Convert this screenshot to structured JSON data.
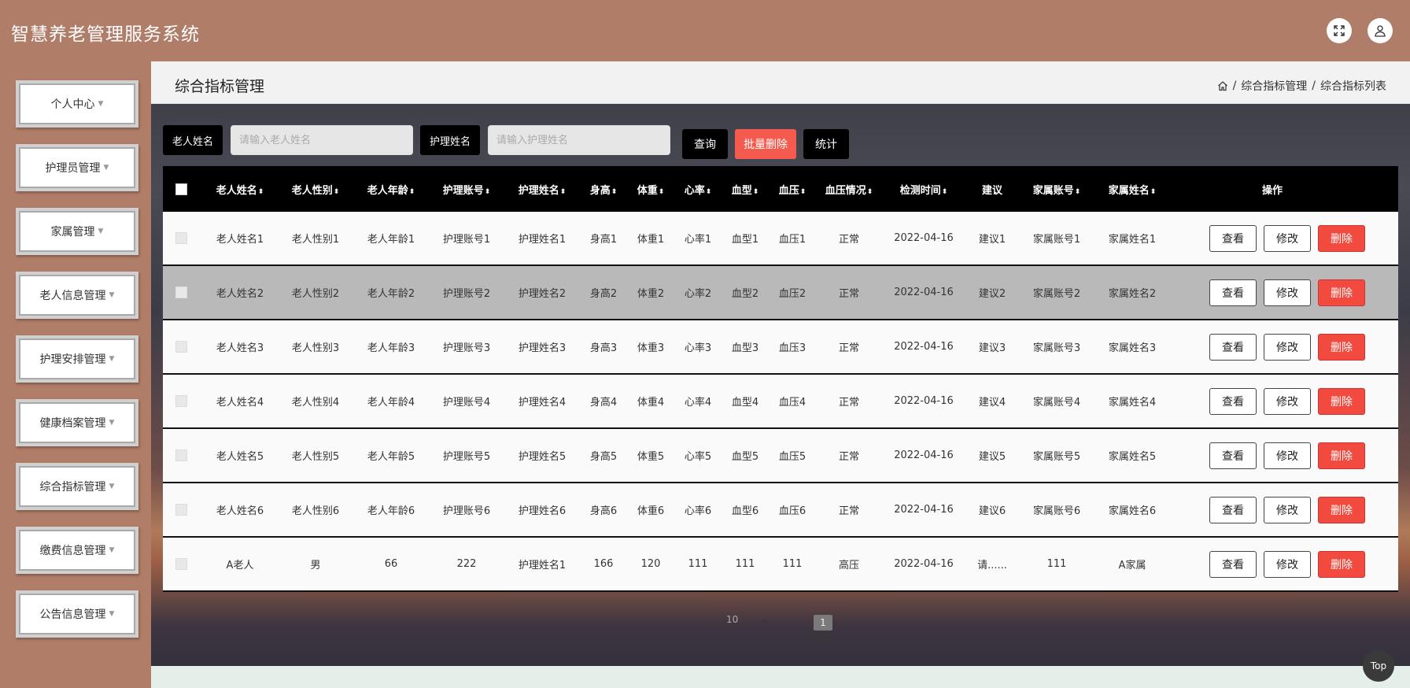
{
  "app": {
    "title": "智慧养老管理服务系统"
  },
  "sidebar": {
    "items": [
      {
        "label": "个人中心"
      },
      {
        "label": "护理员管理"
      },
      {
        "label": "家属管理"
      },
      {
        "label": "老人信息管理"
      },
      {
        "label": "护理安排管理"
      },
      {
        "label": "健康档案管理"
      },
      {
        "label": "综合指标管理"
      },
      {
        "label": "缴费信息管理"
      },
      {
        "label": "公告信息管理"
      }
    ]
  },
  "page": {
    "title": "综合指标管理"
  },
  "breadcrumb": {
    "items": [
      "综合指标管理",
      "综合指标列表"
    ],
    "separator": "/"
  },
  "filters": {
    "elder_label": "老人姓名",
    "elder_placeholder": "请输入老人姓名",
    "nurse_label": "护理姓名",
    "nurse_placeholder": "请输入护理姓名"
  },
  "actions": {
    "query": "查询",
    "batch_delete": "批量删除",
    "stats": "统计"
  },
  "table": {
    "headers": [
      "老人姓名",
      "老人性别",
      "老人年龄",
      "护理账号",
      "护理姓名",
      "身高",
      "体重",
      "心率",
      "血型",
      "血压",
      "血压情况",
      "检测时间",
      "建议",
      "家属账号",
      "家属姓名",
      "操作"
    ],
    "rows": [
      [
        "老人姓名1",
        "老人性别1",
        "老人年龄1",
        "护理账号1",
        "护理姓名1",
        "身高1",
        "体重1",
        "心率1",
        "血型1",
        "血压1",
        "正常",
        "2022-04-16",
        "建议1",
        "家属账号1",
        "家属姓名1"
      ],
      [
        "老人姓名2",
        "老人性别2",
        "老人年龄2",
        "护理账号2",
        "护理姓名2",
        "身高2",
        "体重2",
        "心率2",
        "血型2",
        "血压2",
        "正常",
        "2022-04-16",
        "建议2",
        "家属账号2",
        "家属姓名2"
      ],
      [
        "老人姓名3",
        "老人性别3",
        "老人年龄3",
        "护理账号3",
        "护理姓名3",
        "身高3",
        "体重3",
        "心率3",
        "血型3",
        "血压3",
        "正常",
        "2022-04-16",
        "建议3",
        "家属账号3",
        "家属姓名3"
      ],
      [
        "老人姓名4",
        "老人性别4",
        "老人年龄4",
        "护理账号4",
        "护理姓名4",
        "身高4",
        "体重4",
        "心率4",
        "血型4",
        "血压4",
        "正常",
        "2022-04-16",
        "建议4",
        "家属账号4",
        "家属姓名4"
      ],
      [
        "老人姓名5",
        "老人性别5",
        "老人年龄5",
        "护理账号5",
        "护理姓名5",
        "身高5",
        "体重5",
        "心率5",
        "血型5",
        "血压5",
        "正常",
        "2022-04-16",
        "建议5",
        "家属账号5",
        "家属姓名5"
      ],
      [
        "老人姓名6",
        "老人性别6",
        "老人年龄6",
        "护理账号6",
        "护理姓名6",
        "身高6",
        "体重6",
        "心率6",
        "血型6",
        "血压6",
        "正常",
        "2022-04-16",
        "建议6",
        "家属账号6",
        "家属姓名6"
      ],
      [
        "A老人",
        "男",
        "66",
        "222",
        "护理姓名1",
        "166",
        "120",
        "111",
        "111",
        "111",
        "高压",
        "2022-04-16",
        "请......",
        "111",
        "A家属"
      ]
    ],
    "row_actions": {
      "view": "查看",
      "edit": "修改",
      "delete": "删除"
    }
  },
  "pagination": {
    "page_size": "10",
    "current_page": "1"
  },
  "back_to_top": "Top",
  "icons": {
    "fullscreen": "fullscreen-icon",
    "user": "user-icon",
    "home": "home-icon"
  },
  "colors": {
    "brand": "#b07d68",
    "danger": "#f24a3e",
    "header_black": "#000000"
  }
}
